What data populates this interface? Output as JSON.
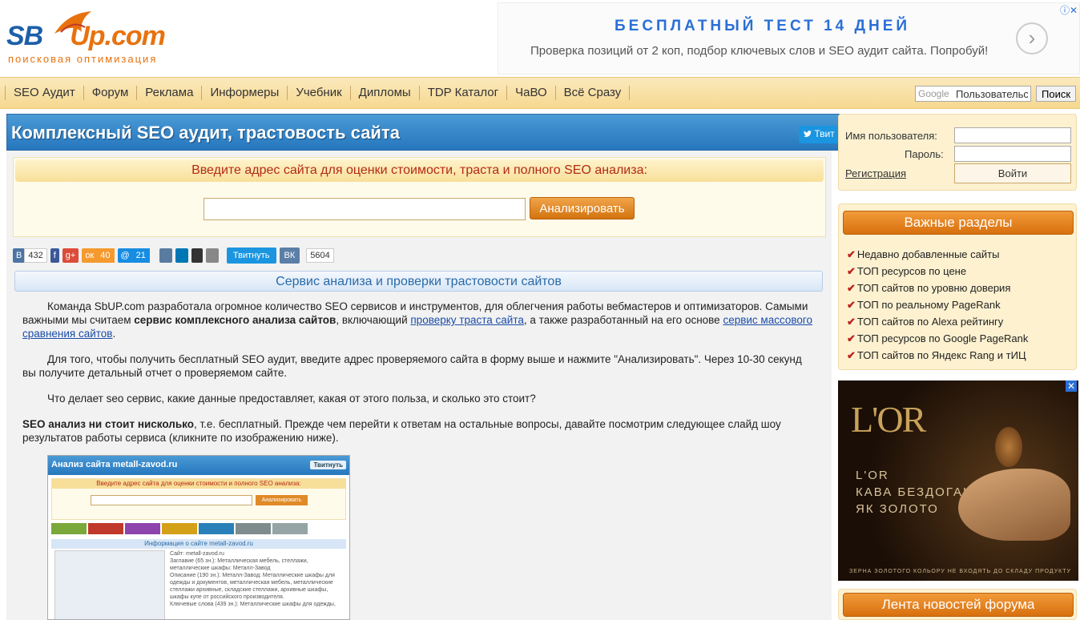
{
  "header": {
    "logo_text_1": "SB",
    "logo_text_2": "Up.com",
    "tagline": "поисковая оптимизация",
    "ad_title": "БЕСПЛАТНЫЙ ТЕСТ 14 ДНЕЙ",
    "ad_text": "Проверка позиций от 2 коп, подбор ключевых слов и SEO аудит сайта. Попробуй!",
    "ad_arrow": "›",
    "ad_choices": "ⓘ✕"
  },
  "nav": {
    "items": [
      "SEO Аудит",
      "Форум",
      "Реклама",
      "Информеры",
      "Учебник",
      "Дипломы",
      "TDP Каталог",
      "ЧаВО",
      "Всё Сразу"
    ],
    "search_brand": "Google",
    "search_placeholder": "Пользовательс",
    "search_button": "Поиск"
  },
  "main": {
    "title": "Комплексный SEO аудит, трастовость сайта",
    "tweet_label": "Твит",
    "form_header": "Введите адрес сайта для оценки стоимости, траста и полного SEO анализа:",
    "url_value": "",
    "analyze_label": "Анализировать",
    "social": {
      "vk": "В",
      "vk_count": "432",
      "fb": "f",
      "gplus": "g+",
      "ok": "ок",
      "ok_count": "40",
      "mail": "@",
      "mail_count": "21",
      "tweet_btn": "Твитнуть",
      "vk_btn": "ВК",
      "like_count": "5604"
    },
    "section_title": "Сервис анализа и проверки трастовости сайтов",
    "p1_a": "Команда SbUP.com разработала огромное количество SEO сервисов и инструментов, для облегчения работы вебмастеров и оптимизаторов.  Самыми важными мы считаем ",
    "p1_b": "сервис комплексного анализа сайтов",
    "p1_c": ", включающий ",
    "p1_link1": "проверку траста сайта",
    "p1_d": ", а также разработанный на его основе ",
    "p1_link2": "сервис массового сравнения сайтов",
    "p1_e": ".",
    "p2": "Для того, чтобы получить бесплатный SEO аудит, введите адрес проверяемого сайта в форму выше и нажмите \"Анализировать\". Через 10-30 секунд вы получите детальный отчет о проверяемом сайте.",
    "p3": "Что делает seo сервис, какие данные предоставляет, какая от этого польза, и сколько это стоит?",
    "p4_b": "SEO анализ ни стоит нисколько",
    "p4_rest": ", т.е. бесплатный. Прежде чем перейти к ответам на остальные вопросы, давайте посмотрим следующее слайд шоу результатов работы сервиса (кликните по изображению ниже).",
    "slide": {
      "title": "Анализ сайта metall-zavod.ru",
      "tweet": "Твитнуть",
      "form_header": "Введите адрес сайта для оценки стоимости и полного SEO анализа:",
      "button": "Анализировать",
      "info": "Информация о сайте metall-zavod.ru",
      "meta": "Сайт: metall-zavod.ru\nЗаглавие (65 зн.): Металлическая мебель, стеллажи, металлические шкафы: Металл-Завод\nОписание (190 зн.): Металл-Завод: Металлические шкафы для одежды и документов, металлическая мебель, металлические стеллажи архивные, складские стеллажи, архивные шкафы, шкафы купе от российского производителя.\nКлючевые слова (439 зн.): Металлические шкафы для одежды,"
    }
  },
  "sidebar": {
    "login": {
      "user_label": "Имя пользователя:",
      "pass_label": "Пароль:",
      "register": "Регистрация",
      "login_button": "Войти"
    },
    "important_title": "Важные разделы",
    "important_items": [
      "Недавно добавленные сайты",
      "ТОП ресурсов по цене",
      "ТОП сайтов по уровню доверия",
      "ТОП по реальному PageRank",
      "ТОП сайтов по Alexa рейтингу",
      "ТОП ресурсов по Google PageRank",
      "ТОП сайтов по Яндекс Rang и тИЦ"
    ],
    "ad": {
      "brand": "L'OR",
      "line1": "L'OR",
      "line2": "КАВА БЕЗДОГАННА,",
      "line3": "ЯК ЗОЛОТО",
      "footer": "ЗЕРНА ЗОЛОТОГО КОЛЬОРУ НЕ ВХОДЯТЬ ДО СКЛАДУ ПРОДУКТУ"
    },
    "news_title": "Лента новостей форума"
  }
}
